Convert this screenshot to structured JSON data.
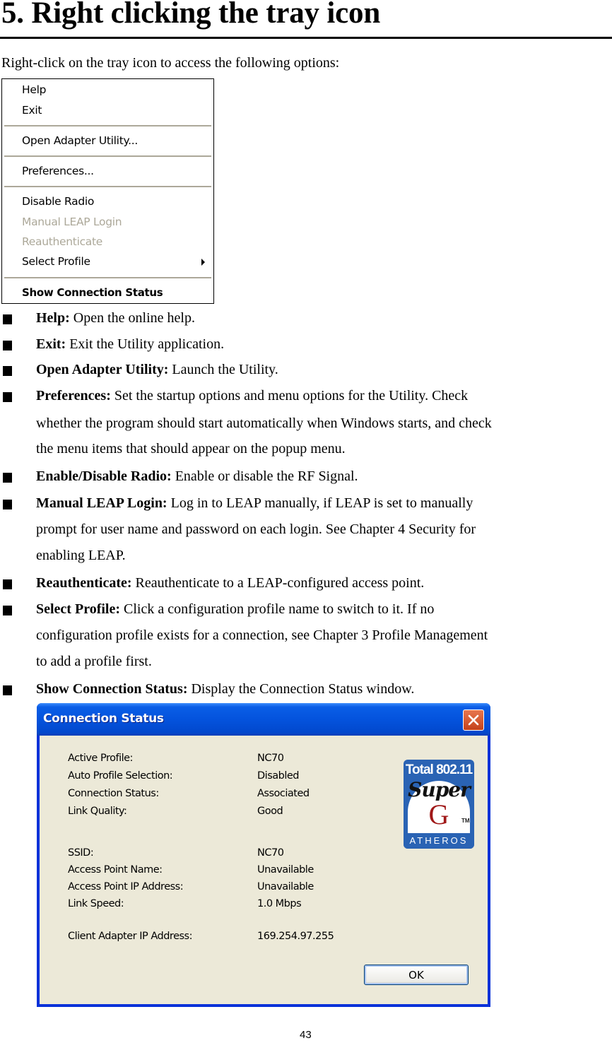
{
  "heading": "5. Right clicking the tray icon",
  "intro": "Right-click on the tray icon to access the following options:",
  "context_menu": {
    "items": [
      {
        "label": "Help",
        "state": "enabled"
      },
      {
        "label": "Exit",
        "state": "enabled"
      },
      {
        "label": "Open Adapter Utility...",
        "state": "enabled"
      },
      {
        "label": "Preferences...",
        "state": "enabled"
      },
      {
        "label": "Disable Radio",
        "state": "enabled"
      },
      {
        "label": "Manual LEAP Login",
        "state": "disabled"
      },
      {
        "label": "Reauthenticate",
        "state": "disabled"
      },
      {
        "label": "Select Profile",
        "state": "enabled",
        "submenu": true
      },
      {
        "label": "Show Connection Status",
        "state": "default"
      }
    ]
  },
  "descriptions": [
    {
      "term": "Help:",
      "lines": [
        " Open the online help."
      ]
    },
    {
      "term": "Exit:",
      "lines": [
        " Exit the Utility application."
      ]
    },
    {
      "term": "Open Adapter Utility:",
      "lines": [
        " Launch the Utility."
      ]
    },
    {
      "term": "Preferences:",
      "lines": [
        " Set the startup options and menu options for the Utility. Check",
        "whether the program should start automatically when Windows starts, and check",
        "the menu items that should appear on the popup menu."
      ]
    },
    {
      "term": "Enable/Disable Radio:",
      "lines": [
        " Enable or disable the RF Signal."
      ]
    },
    {
      "term": "Manual LEAP Login:",
      "lines": [
        " Log in to LEAP manually, if LEAP is set to manually",
        "prompt for user name and password on each login. See Chapter 4 Security for",
        "enabling LEAP."
      ]
    },
    {
      "term": "Reauthenticate:",
      "lines": [
        " Reauthenticate to a LEAP-configured access point."
      ]
    },
    {
      "term": "Select Profile:",
      "lines": [
        " Click a configuration profile name to switch to it. If no",
        "configuration profile exists for a connection, see Chapter 3 Profile Management",
        "to add a profile first."
      ]
    },
    {
      "term": "Show Connection Status:",
      "lines": [
        " Display the Connection Status window."
      ]
    }
  ],
  "dialog": {
    "title": "Connection Status",
    "close_icon": "close-x",
    "fields": [
      {
        "label": "Active Profile:",
        "value": "NC70"
      },
      {
        "label": "Auto Profile Selection:",
        "value": "Disabled"
      },
      {
        "label": "Connection Status:",
        "value": "Associated"
      },
      {
        "label": "Link Quality:",
        "value": "Good"
      },
      {
        "label": "SSID:",
        "value": "NC70"
      },
      {
        "label": "Access Point Name:",
        "value": "Unavailable"
      },
      {
        "label": "Access Point IP Address:",
        "value": "Unavailable"
      },
      {
        "label": "Link Speed:",
        "value": "1.0 Mbps"
      },
      {
        "label": "Client Adapter IP Address:",
        "value": "169.254.97.255"
      }
    ],
    "logo": {
      "top_text": "Total 802.11",
      "script_text": "Super",
      "letter": "G",
      "tm": "TM",
      "brand": "ATHEROS"
    },
    "ok_label": "OK"
  },
  "page_number": "43"
}
